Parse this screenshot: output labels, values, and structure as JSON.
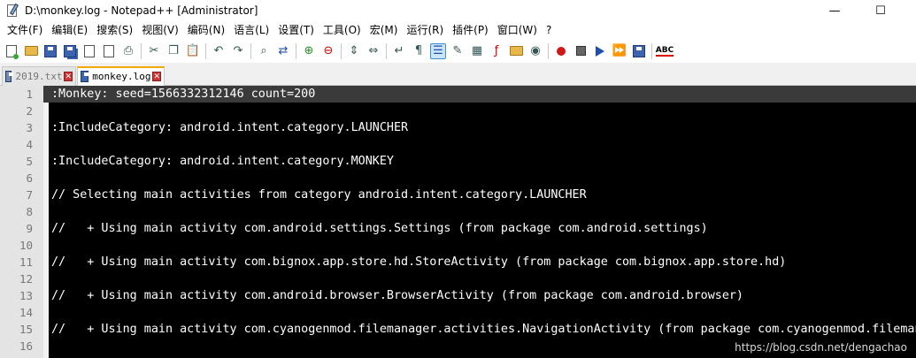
{
  "window": {
    "title": "D:\\monkey.log - Notepad++ [Administrator]",
    "minimize_glyph": "—",
    "maximize_glyph": "☐"
  },
  "menu": [
    "文件(F)",
    "编辑(E)",
    "搜索(S)",
    "视图(V)",
    "编码(N)",
    "语言(L)",
    "设置(T)",
    "工具(O)",
    "宏(M)",
    "运行(R)",
    "插件(P)",
    "窗口(W)",
    "?"
  ],
  "toolbar": {
    "spell_check_label": "ABC"
  },
  "tabs": [
    {
      "label": "2019.txt",
      "close": "✕"
    },
    {
      "label": "monkey.log",
      "close": "✕"
    }
  ],
  "editor": {
    "current_line": 1,
    "lines": [
      {
        "n": "1",
        "text": ":Monkey: seed=1566332312146 count=200"
      },
      {
        "n": "2",
        "text": ""
      },
      {
        "n": "3",
        "text": ":IncludeCategory: android.intent.category.LAUNCHER"
      },
      {
        "n": "4",
        "text": ""
      },
      {
        "n": "5",
        "text": ":IncludeCategory: android.intent.category.MONKEY"
      },
      {
        "n": "6",
        "text": ""
      },
      {
        "n": "7",
        "text": "// Selecting main activities from category android.intent.category.LAUNCHER"
      },
      {
        "n": "8",
        "text": ""
      },
      {
        "n": "9",
        "text": "//   + Using main activity com.android.settings.Settings (from package com.android.settings)"
      },
      {
        "n": "10",
        "text": ""
      },
      {
        "n": "11",
        "text": "//   + Using main activity com.bignox.app.store.hd.StoreActivity (from package com.bignox.app.store.hd)"
      },
      {
        "n": "12",
        "text": ""
      },
      {
        "n": "13",
        "text": "//   + Using main activity com.android.browser.BrowserActivity (from package com.android.browser)"
      },
      {
        "n": "14",
        "text": ""
      },
      {
        "n": "15",
        "text": "//   + Using main activity com.cyanogenmod.filemanager.activities.NavigationActivity (from package com.cyanogenmod.filemanager)"
      },
      {
        "n": "16",
        "text": ""
      }
    ]
  },
  "watermark": "https://blog.csdn.net/dengachao"
}
